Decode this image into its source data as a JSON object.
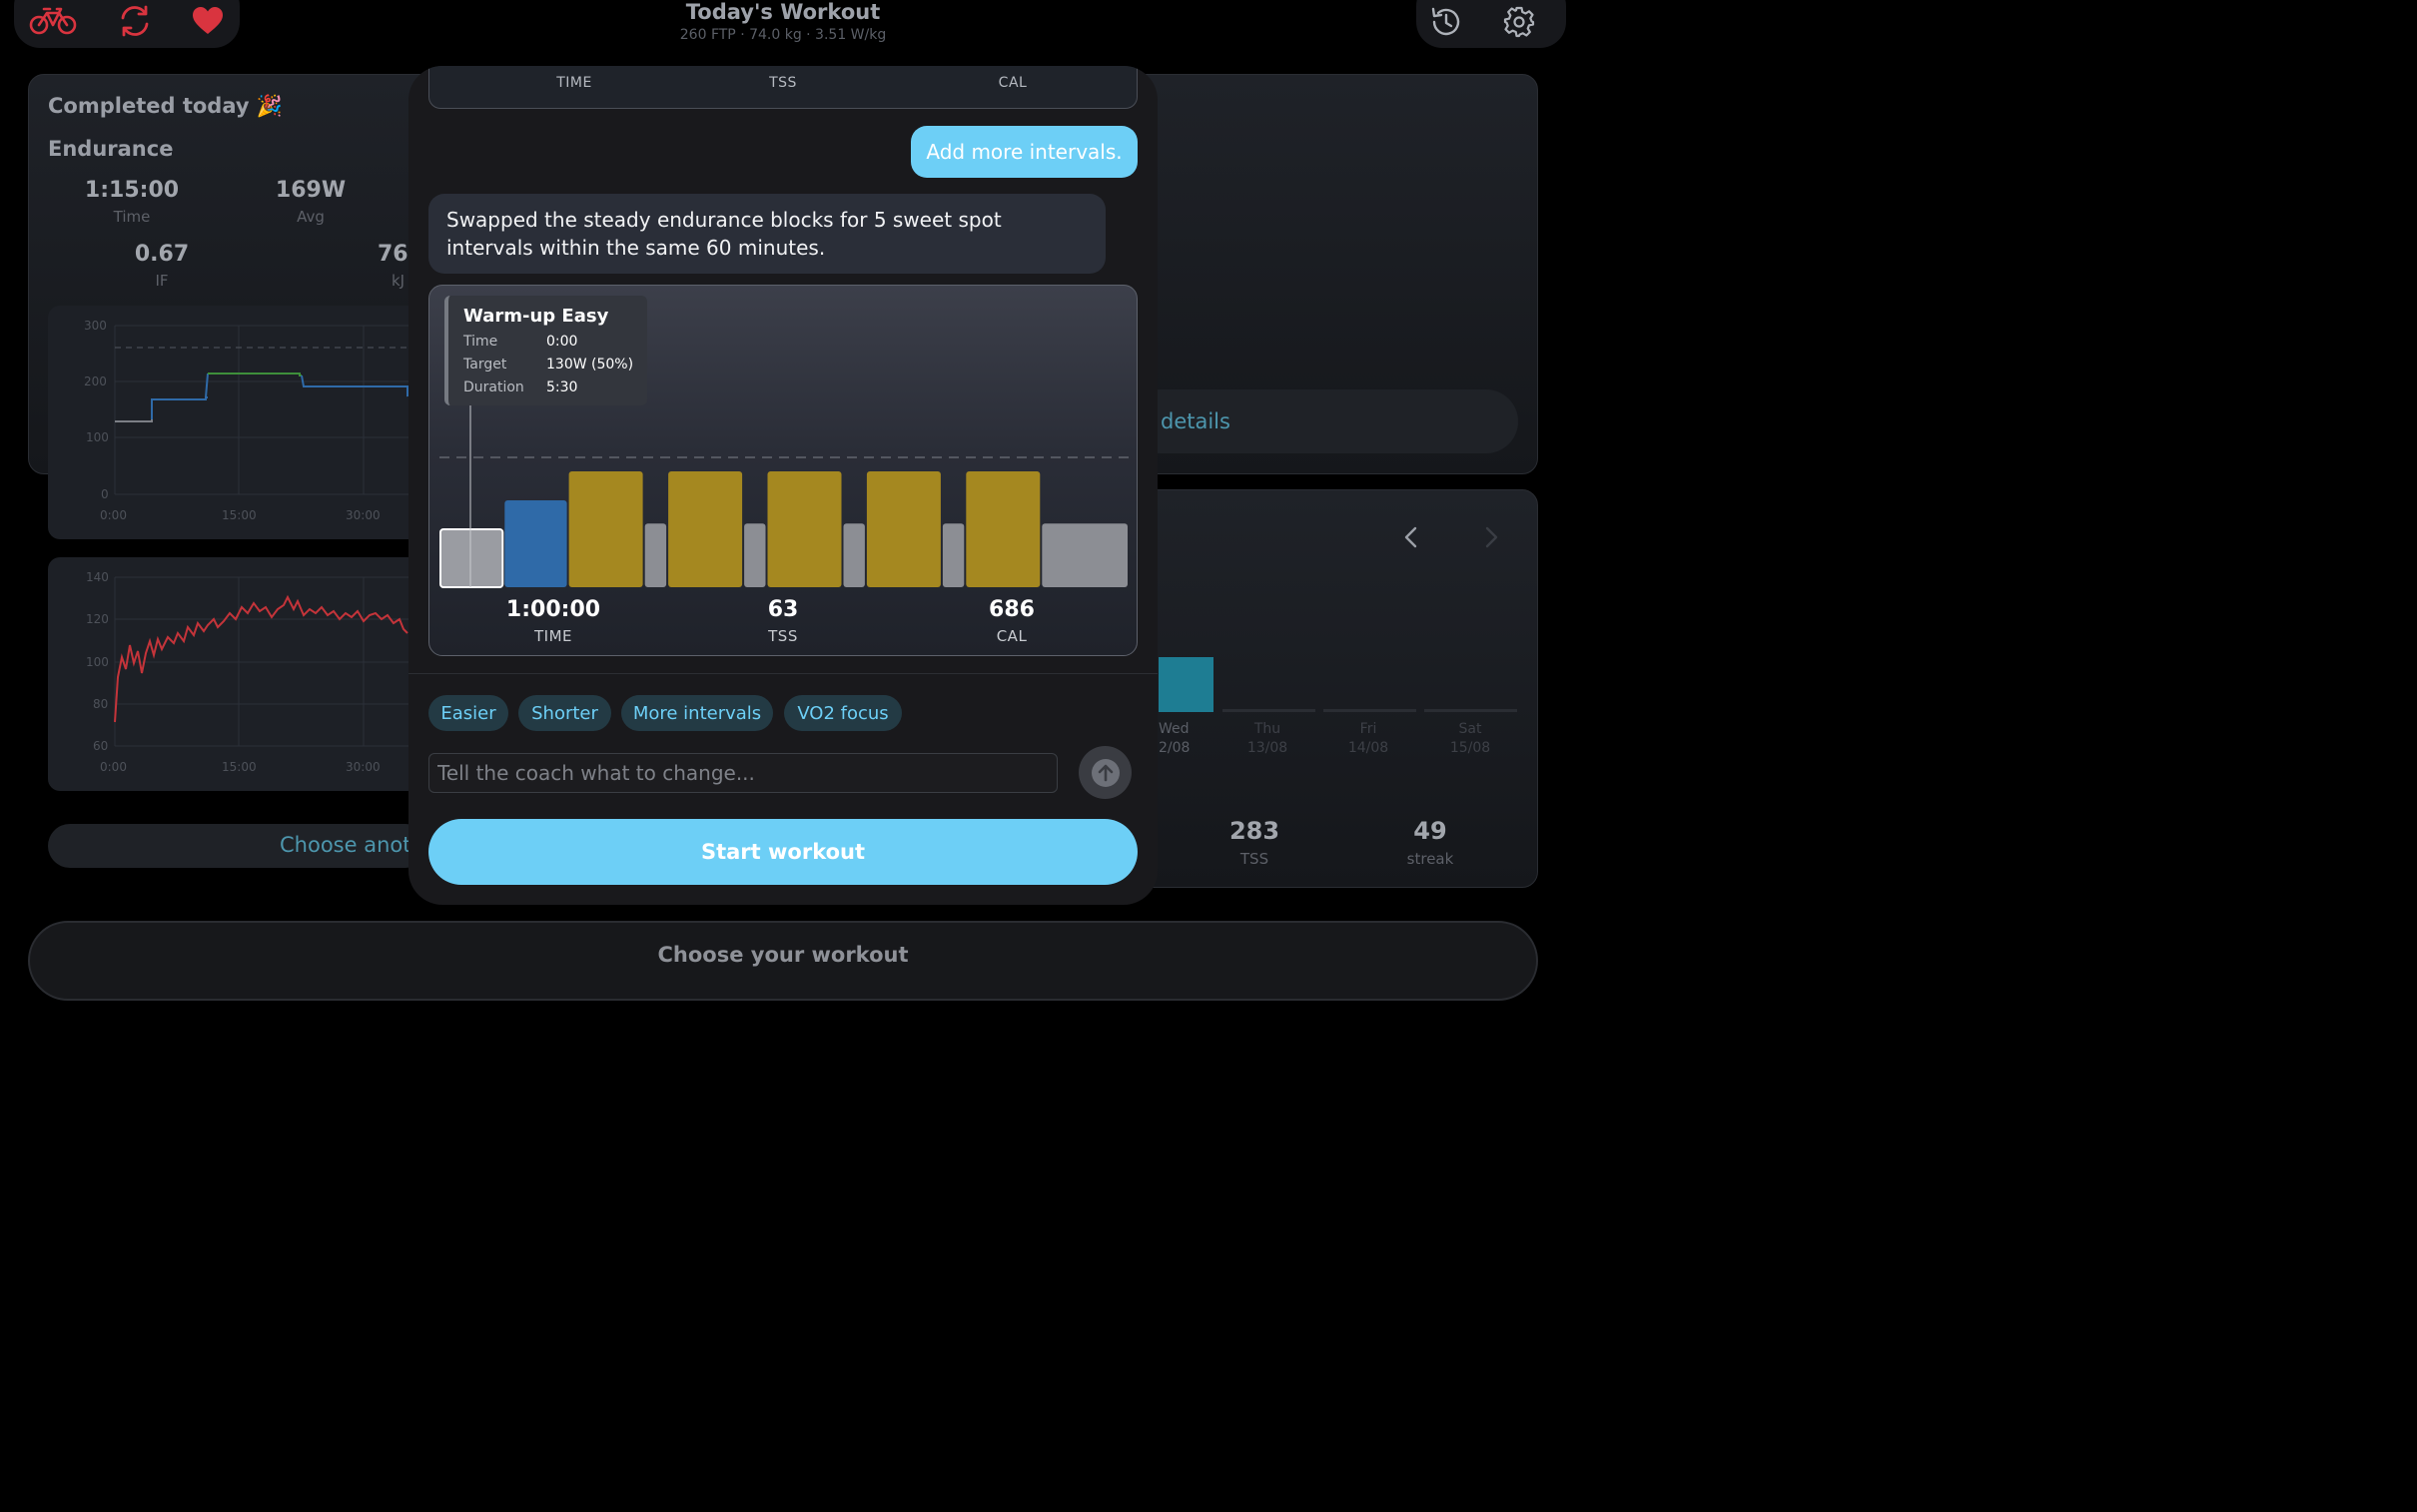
{
  "header": {
    "title": "Today's Workout",
    "subtitle": "260 FTP · 74.0 kg · 3.51 W/kg"
  },
  "colors": {
    "accent": "#6dcff6",
    "icon_red": "#d9343f",
    "sweet_spot": "#a58820",
    "endurance": "#2f6aa8",
    "recovery": "#8c8e94"
  },
  "completed": {
    "title": "Completed today 🎉",
    "workout_name": "Endurance",
    "stats": [
      {
        "value": "1:15:00",
        "label": "Time"
      },
      {
        "value": "169W",
        "label": "Avg"
      },
      {
        "value": "0.67",
        "label": "IF"
      },
      {
        "value": "76",
        "label": "kJ"
      }
    ],
    "power_chart": {
      "y_ticks": [
        "300",
        "200",
        "100",
        "0"
      ],
      "x_ticks": [
        "0:00",
        "15:00",
        "30:00"
      ]
    },
    "hr_chart": {
      "y_ticks": [
        "140",
        "120",
        "100",
        "80",
        "60"
      ],
      "x_ticks": [
        "0:00",
        "15:00",
        "30:00"
      ]
    },
    "choose_another": "Choose anoth",
    "details_label": "details"
  },
  "week": {
    "days": [
      {
        "name": "Wed",
        "date": "2/08"
      },
      {
        "name": "Thu",
        "date": "13/08"
      },
      {
        "name": "Fri",
        "date": "14/08"
      },
      {
        "name": "Sat",
        "date": "15/08"
      }
    ],
    "stats": [
      {
        "value": "283",
        "label": "TSS"
      },
      {
        "value": "49",
        "label": "streak"
      }
    ]
  },
  "choose_workout": "Choose your workout",
  "modal": {
    "top_labels": [
      "TIME",
      "TSS",
      "CAL"
    ],
    "user_message": "Add more intervals.",
    "coach_message": "Swapped the steady endurance blocks for 5 sweet spot intervals within the same 60 minutes.",
    "tooltip": {
      "title": "Warm-up Easy",
      "rows": [
        {
          "key": "Time",
          "value": "0:00"
        },
        {
          "key": "Target",
          "value": "130W (50%)"
        },
        {
          "key": "Duration",
          "value": "5:30"
        }
      ]
    },
    "summary": [
      {
        "value": "1:00:00",
        "label": "TIME"
      },
      {
        "value": "63",
        "label": "TSS"
      },
      {
        "value": "686",
        "label": "CAL"
      }
    ],
    "chips": [
      "Easier",
      "Shorter",
      "More intervals",
      "VO2 focus"
    ],
    "input_placeholder": "Tell the coach what to change...",
    "start_label": "Start workout"
  },
  "workout_segments": [
    {
      "zone": "warmup",
      "minutes": 5.5,
      "pct_ftp": 50
    },
    {
      "zone": "endurance",
      "minutes": 5.5,
      "pct_ftp": 75
    },
    {
      "zone": "sweet_spot",
      "minutes": 6.5,
      "pct_ftp": 100
    },
    {
      "zone": "recovery",
      "minutes": 2,
      "pct_ftp": 55
    },
    {
      "zone": "sweet_spot",
      "minutes": 6.5,
      "pct_ftp": 100
    },
    {
      "zone": "recovery",
      "minutes": 2,
      "pct_ftp": 55
    },
    {
      "zone": "sweet_spot",
      "minutes": 6.5,
      "pct_ftp": 100
    },
    {
      "zone": "recovery",
      "minutes": 2,
      "pct_ftp": 55
    },
    {
      "zone": "sweet_spot",
      "minutes": 6.5,
      "pct_ftp": 100
    },
    {
      "zone": "recovery",
      "minutes": 2,
      "pct_ftp": 55
    },
    {
      "zone": "sweet_spot",
      "minutes": 6.5,
      "pct_ftp": 100
    },
    {
      "zone": "cooldown",
      "minutes": 7.5,
      "pct_ftp": 55
    }
  ]
}
